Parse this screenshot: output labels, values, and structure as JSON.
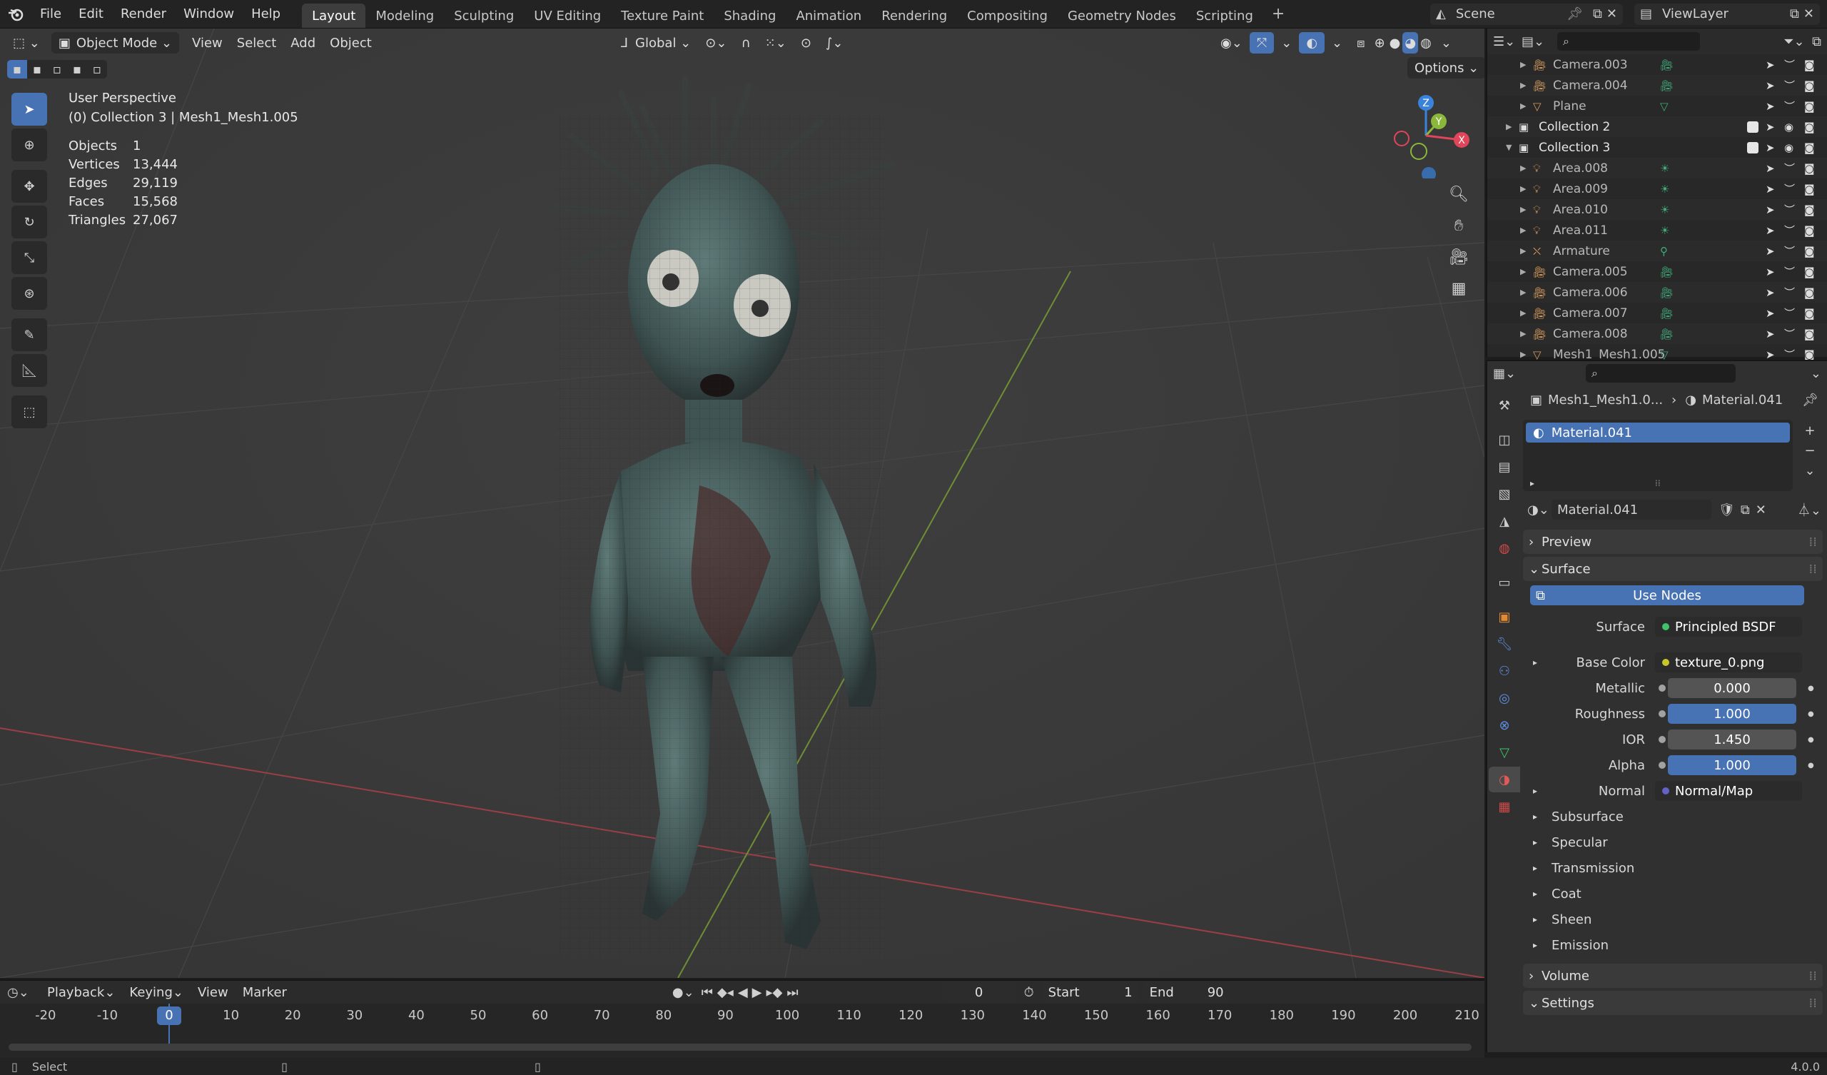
{
  "topbar": {
    "menus": [
      "File",
      "Edit",
      "Render",
      "Window",
      "Help"
    ],
    "workspaces": [
      "Layout",
      "Modeling",
      "Sculpting",
      "UV Editing",
      "Texture Paint",
      "Shading",
      "Animation",
      "Rendering",
      "Compositing",
      "Geometry Nodes",
      "Scripting"
    ],
    "active_workspace": "Layout",
    "scene": "Scene",
    "view_layer": "ViewLayer"
  },
  "viewport": {
    "mode": "Object Mode",
    "menus": [
      "View",
      "Select",
      "Add",
      "Object"
    ],
    "orientation": "Global",
    "options": "Options",
    "overlay_title": "User Perspective",
    "overlay_subtitle": "(0) Collection 3 | Mesh1_Mesh1.005",
    "stats": [
      {
        "label": "Objects",
        "value": "1"
      },
      {
        "label": "Vertices",
        "value": "13,444"
      },
      {
        "label": "Edges",
        "value": "29,119"
      },
      {
        "label": "Faces",
        "value": "15,568"
      },
      {
        "label": "Triangles",
        "value": "27,067"
      }
    ],
    "gizmo": {
      "z": "Z",
      "y": "Y",
      "x": "X"
    }
  },
  "outliner": {
    "rows": [
      {
        "name": "Camera.003",
        "type": "camera",
        "indent": 2
      },
      {
        "name": "Camera.004",
        "type": "camera",
        "indent": 2
      },
      {
        "name": "Plane",
        "type": "mesh",
        "indent": 2
      },
      {
        "name": "Collection 2",
        "type": "collection",
        "indent": 1
      },
      {
        "name": "Collection 3",
        "type": "collection",
        "indent": 1
      },
      {
        "name": "Area.008",
        "type": "light",
        "indent": 2
      },
      {
        "name": "Area.009",
        "type": "light",
        "indent": 2
      },
      {
        "name": "Area.010",
        "type": "light",
        "indent": 2
      },
      {
        "name": "Area.011",
        "type": "light",
        "indent": 2
      },
      {
        "name": "Armature",
        "type": "armature",
        "indent": 2
      },
      {
        "name": "Camera.005",
        "type": "camera",
        "indent": 2
      },
      {
        "name": "Camera.006",
        "type": "camera",
        "indent": 2
      },
      {
        "name": "Camera.007",
        "type": "camera",
        "indent": 2
      },
      {
        "name": "Camera.008",
        "type": "camera",
        "indent": 2
      },
      {
        "name": "Mesh1_Mesh1.005",
        "type": "mesh",
        "indent": 2
      }
    ]
  },
  "properties": {
    "breadcrumb_object": "Mesh1_Mesh1.0...",
    "breadcrumb_material": "Material.041",
    "slot": "Material.041",
    "material_name": "Material.041",
    "panels": {
      "preview": "Preview",
      "surface": "Surface",
      "volume": "Volume",
      "settings": "Settings"
    },
    "use_nodes": "Use Nodes",
    "surface_label": "Surface",
    "surface_value": "Principled BSDF",
    "base_color_label": "Base Color",
    "base_color_value": "texture_0.png",
    "metallic_label": "Metallic",
    "metallic_value": "0.000",
    "roughness_label": "Roughness",
    "roughness_value": "1.000",
    "ior_label": "IOR",
    "ior_value": "1.450",
    "alpha_label": "Alpha",
    "alpha_value": "1.000",
    "normal_label": "Normal",
    "normal_value": "Normal/Map",
    "subpanels": [
      "Subsurface",
      "Specular",
      "Transmission",
      "Coat",
      "Sheen",
      "Emission"
    ]
  },
  "timeline": {
    "menus": [
      "Playback",
      "Keying",
      "View",
      "Marker"
    ],
    "current_frame": "0",
    "start_label": "Start",
    "start_value": "1",
    "end_label": "End",
    "end_value": "90",
    "ticks": [
      "-20",
      "-10",
      "0",
      "10",
      "20",
      "30",
      "40",
      "50",
      "60",
      "70",
      "80",
      "90",
      "100",
      "110",
      "120",
      "130",
      "140",
      "150",
      "160",
      "170",
      "180",
      "190",
      "200",
      "210"
    ],
    "playhead": "0"
  },
  "statusbar": {
    "left": "Select",
    "version": "4.0.0"
  },
  "colors": {
    "accent": "#4772b3",
    "selection": "#4772b3",
    "axis_x": "#e0455a",
    "axis_y": "#8bb83a",
    "axis_z": "#3a83db"
  }
}
